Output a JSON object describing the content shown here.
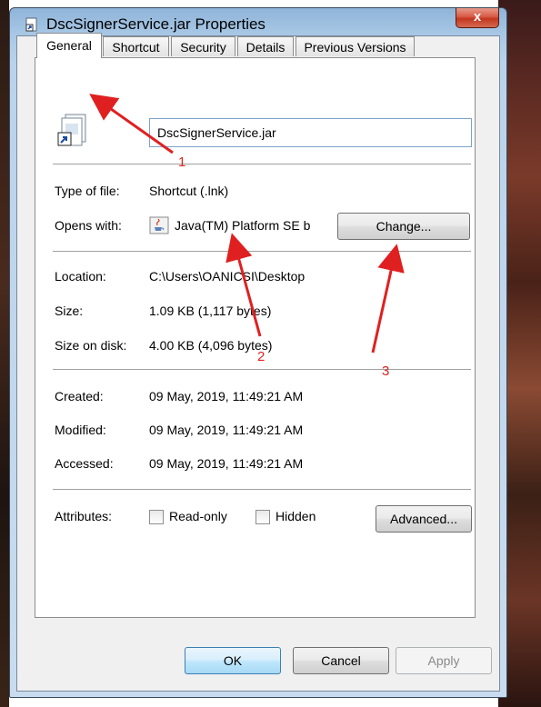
{
  "window": {
    "title": "DscSignerService.jar Properties",
    "close_glyph": "x"
  },
  "tabs": [
    {
      "label": "General",
      "active": true
    },
    {
      "label": "Shortcut",
      "active": false
    },
    {
      "label": "Security",
      "active": false
    },
    {
      "label": "Details",
      "active": false
    },
    {
      "label": "Previous Versions",
      "active": false
    }
  ],
  "general": {
    "file_name": "DscSignerService.jar",
    "type_label": "Type of file:",
    "type_value": "Shortcut (.lnk)",
    "opens_label": "Opens with:",
    "opens_value": "Java(TM) Platform SE b",
    "change_button": "Change...",
    "location_label": "Location:",
    "location_value": "C:\\Users\\OANICSI\\Desktop",
    "size_label": "Size:",
    "size_value": "1.09 KB (1,117 bytes)",
    "size_on_disk_label": "Size on disk:",
    "size_on_disk_value": "4.00 KB (4,096 bytes)",
    "created_label": "Created:",
    "created_value": "09 May, 2019, 11:49:21 AM",
    "modified_label": "Modified:",
    "modified_value": "09 May, 2019, 11:49:21 AM",
    "accessed_label": "Accessed:",
    "accessed_value": "09 May, 2019, 11:49:21 AM",
    "attributes_label": "Attributes:",
    "readonly_label": "Read-only",
    "readonly_checked": false,
    "hidden_label": "Hidden",
    "hidden_checked": false,
    "advanced_button": "Advanced..."
  },
  "footer": {
    "ok": "OK",
    "cancel": "Cancel",
    "apply": "Apply"
  },
  "annotations": {
    "marker_1": "1",
    "marker_2": "2",
    "marker_3": "3",
    "color": "#e02020"
  },
  "icons": {
    "title_icon": "shortcut-file-icon",
    "file_icon": "shortcut-file-icon",
    "app_icon": "java-cup-icon"
  }
}
